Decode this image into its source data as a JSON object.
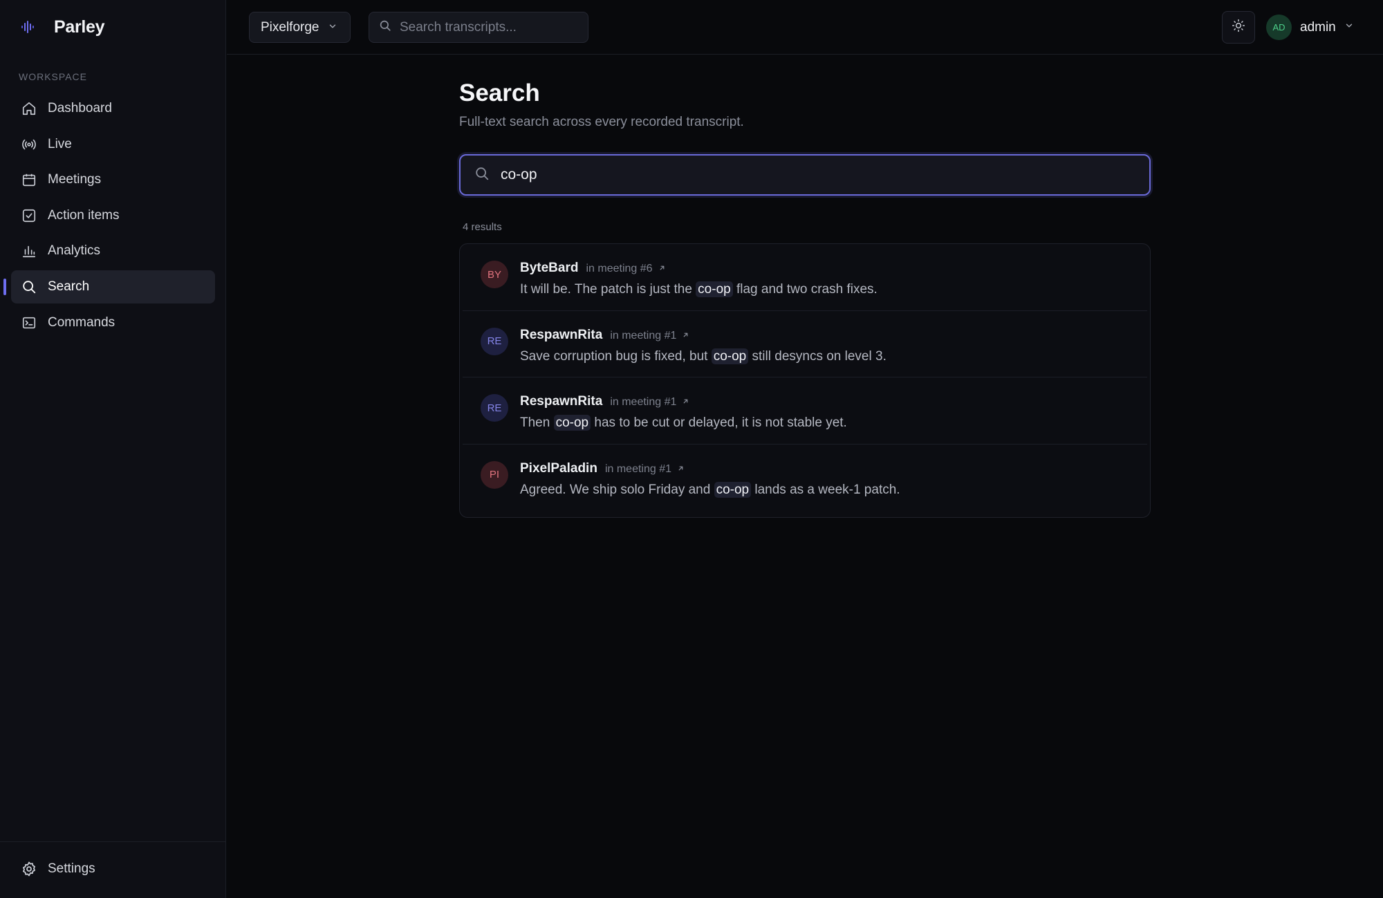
{
  "app": {
    "name": "Parley",
    "accent": "#6e6ef0"
  },
  "sidebar": {
    "section_label": "WORKSPACE",
    "items": [
      {
        "label": "Dashboard",
        "icon": "home-icon"
      },
      {
        "label": "Live",
        "icon": "broadcast-icon"
      },
      {
        "label": "Meetings",
        "icon": "calendar-icon"
      },
      {
        "label": "Action items",
        "icon": "check-square-icon"
      },
      {
        "label": "Analytics",
        "icon": "bar-chart-icon"
      },
      {
        "label": "Search",
        "icon": "search-icon",
        "active": true
      },
      {
        "label": "Commands",
        "icon": "terminal-icon"
      }
    ],
    "footer": {
      "label": "Settings",
      "icon": "gear-icon"
    }
  },
  "header": {
    "org_selector": "Pixelforge",
    "search_placeholder": "Search transcripts...",
    "user": {
      "initials": "AD",
      "name": "admin"
    }
  },
  "main": {
    "title": "Search",
    "subtitle": "Full-text search across every recorded transcript.",
    "query": "co-op",
    "results_count": "4 results",
    "results": [
      {
        "initials": "BY",
        "speaker": "ByteBard",
        "meeting": "in meeting #6",
        "before": "It will be. The patch is just the ",
        "match": "co-op",
        "after": " flag and two crash fixes.",
        "avatar_bg": "#3a1c22",
        "avatar_fg": "#e0737e"
      },
      {
        "initials": "RE",
        "speaker": "RespawnRita",
        "meeting": "in meeting #1",
        "before": "Save corruption bug is fixed, but ",
        "match": "co-op",
        "after": " still desyncs on level 3.",
        "avatar_bg": "#1e2040",
        "avatar_fg": "#8585e8"
      },
      {
        "initials": "RE",
        "speaker": "RespawnRita",
        "meeting": "in meeting #1",
        "before": "Then ",
        "match": "co-op",
        "after": " has to be cut or delayed, it is not stable yet.",
        "avatar_bg": "#1e2040",
        "avatar_fg": "#8585e8"
      },
      {
        "initials": "PI",
        "speaker": "PixelPaladin",
        "meeting": "in meeting #1",
        "before": "Agreed. We ship solo Friday and ",
        "match": "co-op",
        "after": " lands as a week-1 patch.",
        "avatar_bg": "#3a1c22",
        "avatar_fg": "#e0737e"
      }
    ]
  }
}
